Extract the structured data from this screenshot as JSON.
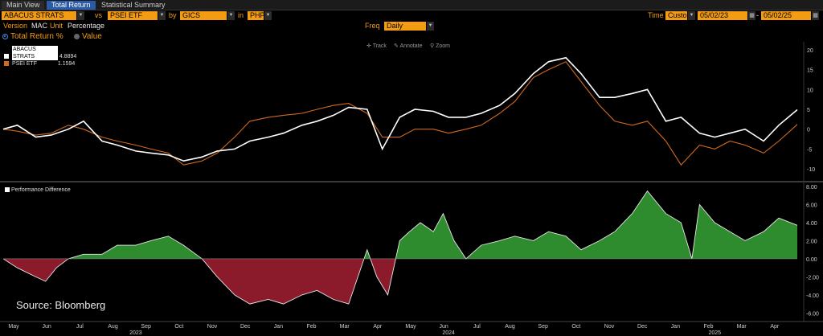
{
  "tabs": [
    {
      "label": "Main View",
      "active": false
    },
    {
      "label": "Total Return",
      "active": true
    },
    {
      "label": "Statistical Summary",
      "active": false
    }
  ],
  "toolbar": {
    "security1": "ABACUS STRATS",
    "vs": "vs",
    "security2": "PSEI ETF",
    "by": "by",
    "grouping": "GICS Sectors",
    "in": "in",
    "currency": "PHP",
    "time_label": "Time",
    "time_mode": "Custo",
    "start_date": "05/02/23",
    "end_date": "05/02/25"
  },
  "row2": {
    "version_label": "Version",
    "version_value": "MAC",
    "unit_label": "Unit",
    "unit_value": "Percentage",
    "freq_label": "Freq",
    "freq_value": "Daily"
  },
  "view_toggle": {
    "option1": "Total Return %",
    "option2": "Value",
    "selected": "Total Return %"
  },
  "chart_tools": {
    "track": "Track",
    "annotate": "Annotate",
    "zoom": "Zoom"
  },
  "colors": {
    "accent": "#f39c12",
    "abacus": "#ffffff",
    "psei": "#d2691e",
    "positive": "#2e8b2e",
    "negative": "#8b1a2b"
  },
  "source": "Source: Bloomberg",
  "chart_data": [
    {
      "type": "line",
      "x_range": [
        "2023-05-02",
        "2025-05-02"
      ],
      "ylim": [
        -12,
        21
      ],
      "yticks": [
        20,
        15,
        10,
        5,
        0,
        -5,
        -10
      ],
      "series": [
        {
          "name": "ABACUS STRATS",
          "last": "4.8894",
          "points": [
            [
              "2023-05-02",
              0
            ],
            [
              "2023-05-15",
              1
            ],
            [
              "2023-06-01",
              -2
            ],
            [
              "2023-06-15",
              -1.5
            ],
            [
              "2023-07-01",
              0
            ],
            [
              "2023-07-15",
              2
            ],
            [
              "2023-08-01",
              -3
            ],
            [
              "2023-08-15",
              -4
            ],
            [
              "2023-09-01",
              -5.5
            ],
            [
              "2023-09-15",
              -6
            ],
            [
              "2023-10-01",
              -6.5
            ],
            [
              "2023-10-15",
              -8
            ],
            [
              "2023-11-01",
              -7
            ],
            [
              "2023-11-15",
              -5.5
            ],
            [
              "2023-12-01",
              -5
            ],
            [
              "2023-12-15",
              -3
            ],
            [
              "2024-01-01",
              -2
            ],
            [
              "2024-01-15",
              -1
            ],
            [
              "2024-02-01",
              1
            ],
            [
              "2024-02-15",
              2
            ],
            [
              "2024-03-01",
              3.5
            ],
            [
              "2024-03-15",
              5.5
            ],
            [
              "2024-04-01",
              5
            ],
            [
              "2024-04-15",
              -5
            ],
            [
              "2024-05-01",
              3
            ],
            [
              "2024-05-15",
              5
            ],
            [
              "2024-06-01",
              4.5
            ],
            [
              "2024-06-15",
              3
            ],
            [
              "2024-07-01",
              3
            ],
            [
              "2024-07-15",
              4
            ],
            [
              "2024-08-01",
              6
            ],
            [
              "2024-08-15",
              9
            ],
            [
              "2024-09-01",
              14
            ],
            [
              "2024-09-15",
              17
            ],
            [
              "2024-10-01",
              18
            ],
            [
              "2024-10-15",
              14
            ],
            [
              "2024-11-01",
              8
            ],
            [
              "2024-11-15",
              8
            ],
            [
              "2024-12-01",
              9
            ],
            [
              "2024-12-15",
              10
            ],
            [
              "2025-01-01",
              2
            ],
            [
              "2025-01-15",
              3
            ],
            [
              "2025-02-01",
              -1
            ],
            [
              "2025-02-15",
              -2
            ],
            [
              "2025-03-01",
              -1
            ],
            [
              "2025-03-15",
              0
            ],
            [
              "2025-04-01",
              -3
            ],
            [
              "2025-04-15",
              1
            ],
            [
              "2025-05-02",
              4.9
            ]
          ]
        },
        {
          "name": "PSEI ETF",
          "last": "1.1594",
          "points": [
            [
              "2023-05-02",
              0
            ],
            [
              "2023-05-15",
              -0.5
            ],
            [
              "2023-06-01",
              -1.5
            ],
            [
              "2023-06-15",
              -1
            ],
            [
              "2023-07-01",
              1
            ],
            [
              "2023-07-15",
              0
            ],
            [
              "2023-08-01",
              -2
            ],
            [
              "2023-08-15",
              -3
            ],
            [
              "2023-09-01",
              -4
            ],
            [
              "2023-09-15",
              -5
            ],
            [
              "2023-10-01",
              -6
            ],
            [
              "2023-10-15",
              -9
            ],
            [
              "2023-11-01",
              -8
            ],
            [
              "2023-11-15",
              -6
            ],
            [
              "2023-12-01",
              -2
            ],
            [
              "2023-12-15",
              2
            ],
            [
              "2024-01-01",
              3
            ],
            [
              "2024-01-15",
              3.5
            ],
            [
              "2024-02-01",
              4
            ],
            [
              "2024-02-15",
              5
            ],
            [
              "2024-03-01",
              6
            ],
            [
              "2024-03-15",
              6.5
            ],
            [
              "2024-04-01",
              4
            ],
            [
              "2024-04-15",
              -2
            ],
            [
              "2024-05-01",
              -2
            ],
            [
              "2024-05-15",
              0
            ],
            [
              "2024-06-01",
              0
            ],
            [
              "2024-06-15",
              -1
            ],
            [
              "2024-07-01",
              0
            ],
            [
              "2024-07-15",
              1
            ],
            [
              "2024-08-01",
              4
            ],
            [
              "2024-08-15",
              7
            ],
            [
              "2024-09-01",
              13
            ],
            [
              "2024-09-15",
              15
            ],
            [
              "2024-10-01",
              17
            ],
            [
              "2024-10-15",
              12
            ],
            [
              "2024-11-01",
              6
            ],
            [
              "2024-11-15",
              2
            ],
            [
              "2024-12-01",
              1
            ],
            [
              "2024-12-15",
              2
            ],
            [
              "2025-01-01",
              -3
            ],
            [
              "2025-01-15",
              -9
            ],
            [
              "2025-02-01",
              -4
            ],
            [
              "2025-02-15",
              -5
            ],
            [
              "2025-03-01",
              -3
            ],
            [
              "2025-03-15",
              -4
            ],
            [
              "2025-04-01",
              -6
            ],
            [
              "2025-04-15",
              -3
            ],
            [
              "2025-05-02",
              1.2
            ]
          ]
        }
      ]
    },
    {
      "type": "area",
      "name": "Performance Difference",
      "ylim": [
        -6.5,
        8
      ],
      "yticks": [
        "8.00",
        "6.00",
        "4.00",
        "2.00",
        "0.00",
        "-2.00",
        "-4.00",
        "-6.00"
      ],
      "x_months": [
        "May",
        "Jun",
        "Jul",
        "Aug",
        "Sep",
        "Oct",
        "Nov",
        "Dec",
        "Jan",
        "Feb",
        "Mar",
        "Apr",
        "May",
        "Jun",
        "Jul",
        "Aug",
        "Sep",
        "Oct",
        "Nov",
        "Dec",
        "Jan",
        "Feb",
        "Mar",
        "Apr"
      ],
      "x_years": [
        "2023",
        "2024",
        "2025"
      ],
      "points": [
        [
          "2023-05-02",
          0
        ],
        [
          "2023-05-15",
          -1
        ],
        [
          "2023-06-01",
          -2
        ],
        [
          "2023-06-10",
          -2.5
        ],
        [
          "2023-06-20",
          -1
        ],
        [
          "2023-07-01",
          0
        ],
        [
          "2023-07-15",
          0.5
        ],
        [
          "2023-08-01",
          0.5
        ],
        [
          "2023-08-15",
          1.5
        ],
        [
          "2023-09-01",
          1.5
        ],
        [
          "2023-09-15",
          2
        ],
        [
          "2023-10-01",
          2.5
        ],
        [
          "2023-10-15",
          1.5
        ],
        [
          "2023-11-01",
          0
        ],
        [
          "2023-11-15",
          -2
        ],
        [
          "2023-12-01",
          -4
        ],
        [
          "2023-12-15",
          -5
        ],
        [
          "2024-01-01",
          -4.5
        ],
        [
          "2024-01-15",
          -5
        ],
        [
          "2024-02-01",
          -4
        ],
        [
          "2024-02-15",
          -3.5
        ],
        [
          "2024-03-01",
          -4.5
        ],
        [
          "2024-03-15",
          -5
        ],
        [
          "2024-04-01",
          1
        ],
        [
          "2024-04-10",
          -2
        ],
        [
          "2024-04-20",
          -4
        ],
        [
          "2024-05-01",
          2
        ],
        [
          "2024-05-10",
          3
        ],
        [
          "2024-05-20",
          4
        ],
        [
          "2024-06-01",
          3
        ],
        [
          "2024-06-10",
          5
        ],
        [
          "2024-06-20",
          2
        ],
        [
          "2024-07-01",
          0
        ],
        [
          "2024-07-15",
          1.5
        ],
        [
          "2024-08-01",
          2
        ],
        [
          "2024-08-15",
          2.5
        ],
        [
          "2024-09-01",
          2
        ],
        [
          "2024-09-15",
          3
        ],
        [
          "2024-10-01",
          2.5
        ],
        [
          "2024-10-15",
          1
        ],
        [
          "2024-11-01",
          2
        ],
        [
          "2024-11-15",
          3
        ],
        [
          "2024-12-01",
          5
        ],
        [
          "2024-12-15",
          7.5
        ],
        [
          "2025-01-01",
          5
        ],
        [
          "2025-01-15",
          4
        ],
        [
          "2025-01-25",
          0
        ],
        [
          "2025-02-01",
          6
        ],
        [
          "2025-02-15",
          4
        ],
        [
          "2025-03-01",
          3
        ],
        [
          "2025-03-15",
          2
        ],
        [
          "2025-04-01",
          3
        ],
        [
          "2025-04-15",
          4.5
        ],
        [
          "2025-05-02",
          3.7
        ]
      ]
    }
  ]
}
